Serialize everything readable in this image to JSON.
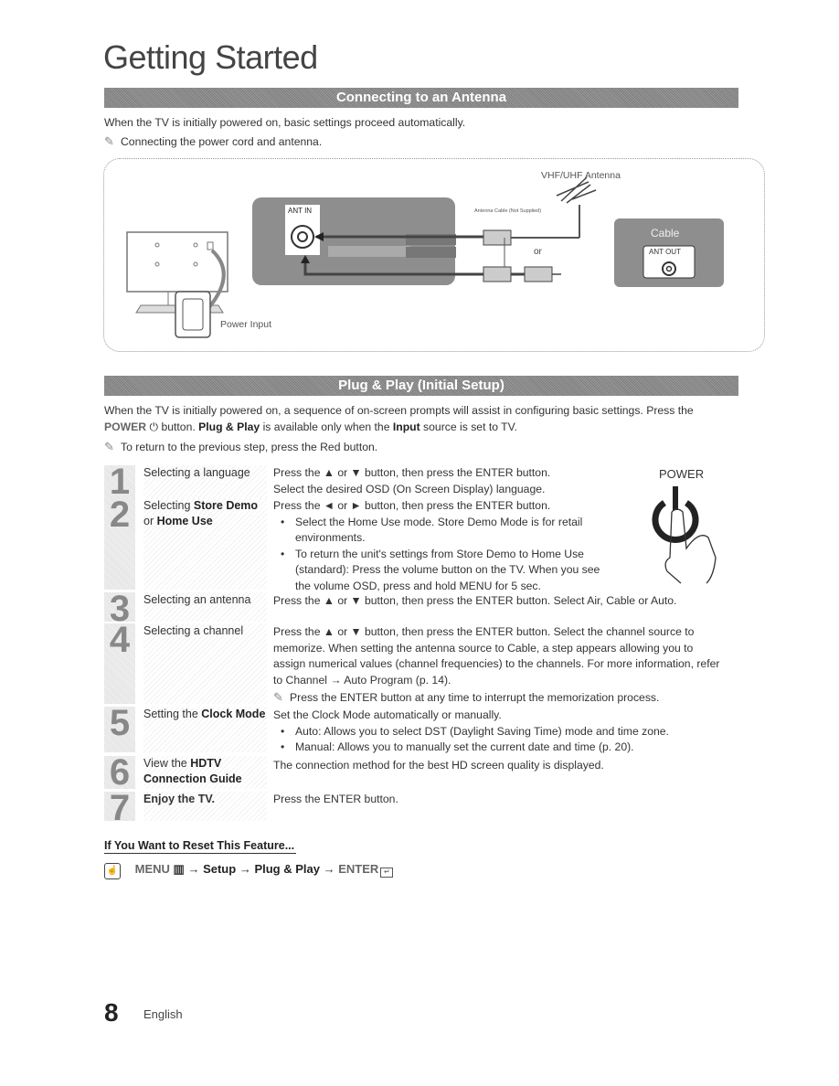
{
  "page": {
    "title": "Getting Started",
    "page_number": "8",
    "language": "English"
  },
  "section_antenna": {
    "heading": "Connecting to an Antenna",
    "intro": "When the TV is initially powered on, basic settings proceed automatically.",
    "note": "Connecting the power cord and antenna.",
    "diagram": {
      "antenna_label": "VHF/UHF Antenna",
      "cable_label": "Antenna Cable (Not Supplied)",
      "ant_in_label": "ANT IN",
      "or_label": "or",
      "cable_box_label": "Cable",
      "ant_out_label": "ANT OUT",
      "power_input_label": "Power Input"
    }
  },
  "section_plug_play": {
    "heading": "Plug & Play (Initial Setup)",
    "intro_1": "When the TV is initially powered on, a sequence of on-screen prompts will assist in configuring basic settings. Press the",
    "power_word": "POWER",
    "intro_2": "button.",
    "plug_play": "Plug & Play",
    "intro_3": "is available only when the",
    "input_word": "Input",
    "intro_4": "source is set to TV.",
    "note": "To return to the previous step, press the Red button.",
    "power_illustration_label": "POWER",
    "steps": [
      {
        "num": "1",
        "label": "Selecting a language",
        "lines": [
          "Press the ▲ or ▼ button, then press the ENTER button.",
          "Select the desired OSD (On Screen Display) language."
        ]
      },
      {
        "num": "2",
        "label_a": "Selecting ",
        "label_b": "Store Demo",
        "label_c": "or ",
        "label_d": "Home Use",
        "line": "Press the ◄ or ► button, then press the ENTER button.",
        "bullet_1": "Select the Home Use mode. Store Demo Mode is for retail environments.",
        "bullet_2": "To return the unit's settings from Store Demo to Home Use (standard): Press the volume button on the TV. When you see the volume OSD, press and hold MENU for 5 sec."
      },
      {
        "num": "3",
        "label": "Selecting an antenna",
        "line": "Press the ▲ or ▼ button, then press the ENTER button. Select Air, Cable or Auto."
      },
      {
        "num": "4",
        "label": "Selecting a channel",
        "line": "Press the ▲ or ▼ button, then press the ENTER button. Select the channel source to memorize. When setting the antenna source to Cable, a step appears allowing you to assign numerical values (channel frequencies) to the channels. For more information, refer to Channel → Auto Program (p. 14).",
        "note": "Press the ENTER button at any time to interrupt the memorization process."
      },
      {
        "num": "5",
        "label_a": "Setting the ",
        "label_b": "Clock Mode",
        "line": "Set the Clock Mode automatically or manually.",
        "bullet_1": "Auto: Allows you to select DST (Daylight Saving Time) mode and time zone.",
        "bullet_2": "Manual: Allows you to manually set the current date and time (p. 20)."
      },
      {
        "num": "6",
        "label_a": "View the ",
        "label_b": "HDTV Connection Guide",
        "line": "The connection method for the best HD screen quality is displayed."
      },
      {
        "num": "7",
        "label": "Enjoy the TV.",
        "line": "Press the ENTER button."
      }
    ]
  },
  "reset": {
    "title": "If You Want to Reset This Feature...",
    "menu": "MENU",
    "arrow": "→",
    "setup": "Setup",
    "plug_play": "Plug & Play",
    "enter": "ENTER"
  }
}
